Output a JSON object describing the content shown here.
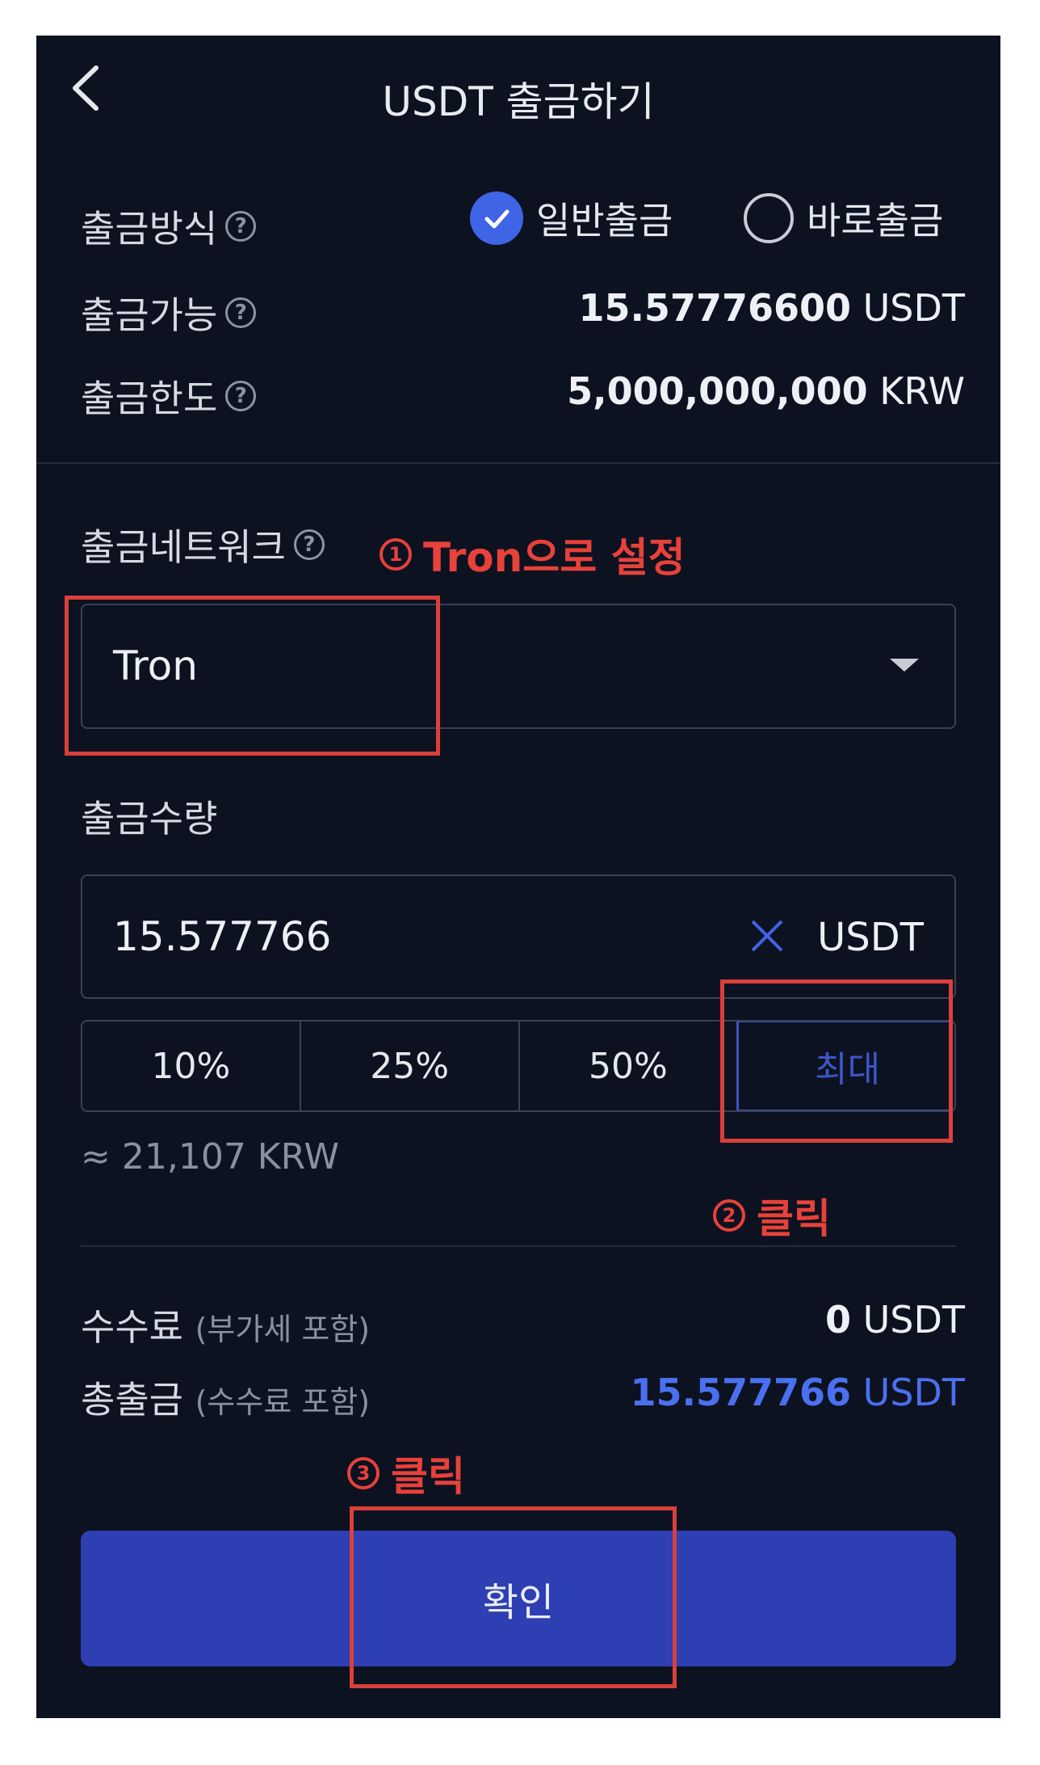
{
  "header": {
    "title": "USDT 출금하기"
  },
  "info": {
    "method_label": "출금방식",
    "method_options": [
      "일반출금",
      "바로출금"
    ],
    "available_label": "출금가능",
    "available_amount": "15.57776600",
    "available_unit": "USDT",
    "limit_label": "출금한도",
    "limit_amount": "5,000,000,000",
    "limit_unit": "KRW"
  },
  "network": {
    "label": "출금네트워크",
    "selected": "Tron"
  },
  "quantity": {
    "label": "출금수량",
    "value": "15.577766",
    "unit": "USDT",
    "percent_buttons": [
      "10%",
      "25%",
      "50%",
      "최대"
    ],
    "krw_estimate": "≈ 21,107 KRW"
  },
  "fees": {
    "fee_label": "수수료",
    "fee_note": "(부가세 포함)",
    "fee_amount": "0",
    "fee_unit": "USDT",
    "total_label": "총출금",
    "total_note": "(수수료 포함)",
    "total_amount": "15.577766",
    "total_unit": "USDT"
  },
  "confirm_label": "확인",
  "annotations": {
    "step1_num": "1",
    "step1_text": "Tron으로 설정",
    "step2_num": "2",
    "step2_text": "클릭",
    "step3_num": "3",
    "step3_text": "클릭"
  },
  "colors": {
    "background": "#0d1221",
    "accent": "#3f64e6",
    "button": "#2d3fb3",
    "annotation": "#e8413a"
  }
}
